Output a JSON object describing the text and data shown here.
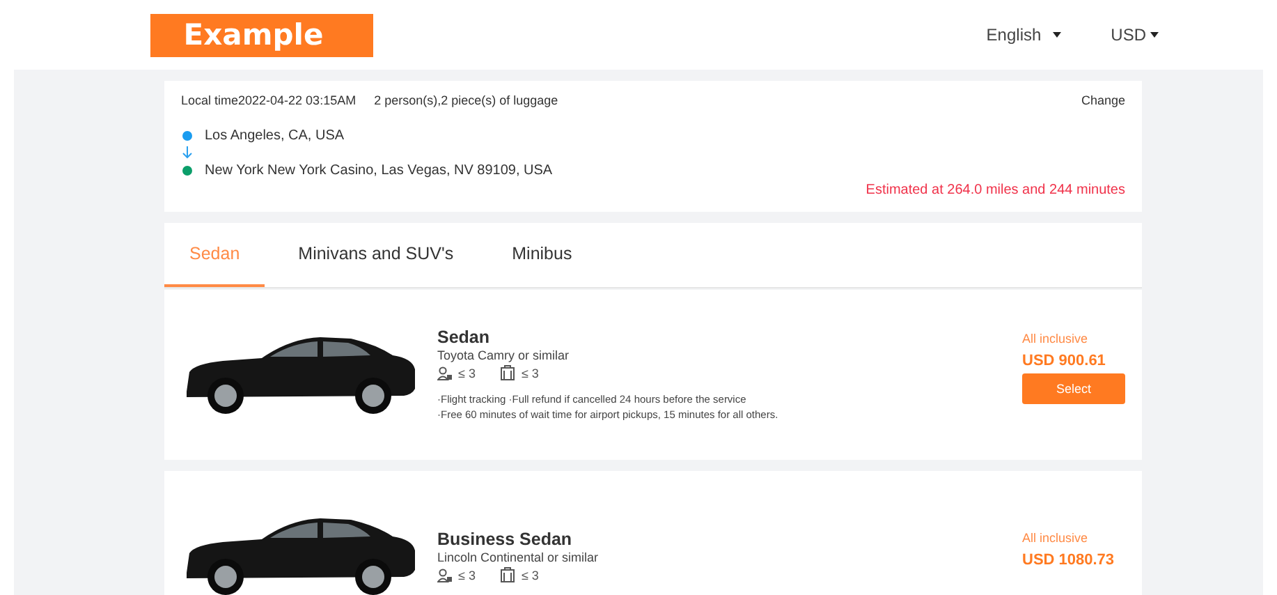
{
  "header": {
    "logo": "Example",
    "language": "English",
    "currency": "USD"
  },
  "trip": {
    "local_time": "Local time2022-04-22 03:15AM",
    "party": "2 person(s),2 piece(s) of luggage",
    "change": "Change",
    "from": "Los Angeles, CA, USA",
    "to": "New York New York Casino, Las Vegas, NV 89109, USA",
    "estimate": "Estimated at 264.0 miles and 244 minutes"
  },
  "tabs": [
    {
      "label": "Sedan",
      "selected": true
    },
    {
      "label": "Minivans and SUV's",
      "selected": false
    },
    {
      "label": "Minibus",
      "selected": false
    }
  ],
  "vehicles": [
    {
      "name": "Sedan",
      "model": "Toyota Camry or similar",
      "passengers": "≤ 3",
      "luggage": "≤ 3",
      "features": [
        "·Flight tracking ·Full refund if cancelled 24 hours before the service",
        "·Free 60 minutes of wait time for airport pickups, 15 minutes for all others."
      ],
      "price_note": "All inclusive",
      "price": "USD 900.61",
      "button": "Select"
    },
    {
      "name": "Business Sedan",
      "model": "Lincoln Continental or similar",
      "passengers": "≤ 3",
      "luggage": "≤ 3",
      "price_note": "All inclusive",
      "price": "USD 1080.73"
    }
  ]
}
